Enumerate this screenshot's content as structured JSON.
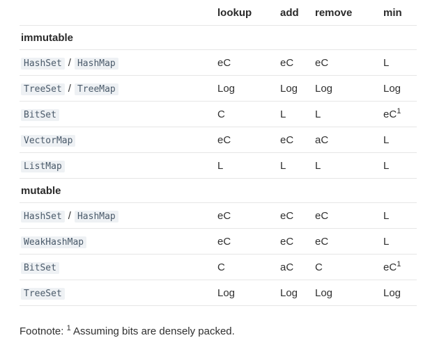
{
  "table": {
    "headers": [
      "",
      "lookup",
      "add",
      "remove",
      "min"
    ],
    "sections": [
      {
        "title": "immutable",
        "rows": [
          {
            "names": [
              "HashSet",
              "HashMap"
            ],
            "lookup": "eC",
            "add": "eC",
            "remove": "eC",
            "min": "L",
            "min_note": ""
          },
          {
            "names": [
              "TreeSet",
              "TreeMap"
            ],
            "lookup": "Log",
            "add": "Log",
            "remove": "Log",
            "min": "Log",
            "min_note": ""
          },
          {
            "names": [
              "BitSet"
            ],
            "lookup": "C",
            "add": "L",
            "remove": "L",
            "min": "eC",
            "min_note": "1"
          },
          {
            "names": [
              "VectorMap"
            ],
            "lookup": "eC",
            "add": "eC",
            "remove": "aC",
            "min": "L",
            "min_note": ""
          },
          {
            "names": [
              "ListMap"
            ],
            "lookup": "L",
            "add": "L",
            "remove": "L",
            "min": "L",
            "min_note": ""
          }
        ]
      },
      {
        "title": "mutable",
        "rows": [
          {
            "names": [
              "HashSet",
              "HashMap"
            ],
            "lookup": "eC",
            "add": "eC",
            "remove": "eC",
            "min": "L",
            "min_note": ""
          },
          {
            "names": [
              "WeakHashMap"
            ],
            "lookup": "eC",
            "add": "eC",
            "remove": "eC",
            "min": "L",
            "min_note": ""
          },
          {
            "names": [
              "BitSet"
            ],
            "lookup": "C",
            "add": "aC",
            "remove": "C",
            "min": "eC",
            "min_note": "1"
          },
          {
            "names": [
              "TreeSet"
            ],
            "lookup": "Log",
            "add": "Log",
            "remove": "Log",
            "min": "Log",
            "min_note": ""
          }
        ]
      }
    ],
    "name_separator": "/"
  },
  "footnote": {
    "label": "Footnote:",
    "marker": "1",
    "text": "Assuming bits are densely packed."
  }
}
